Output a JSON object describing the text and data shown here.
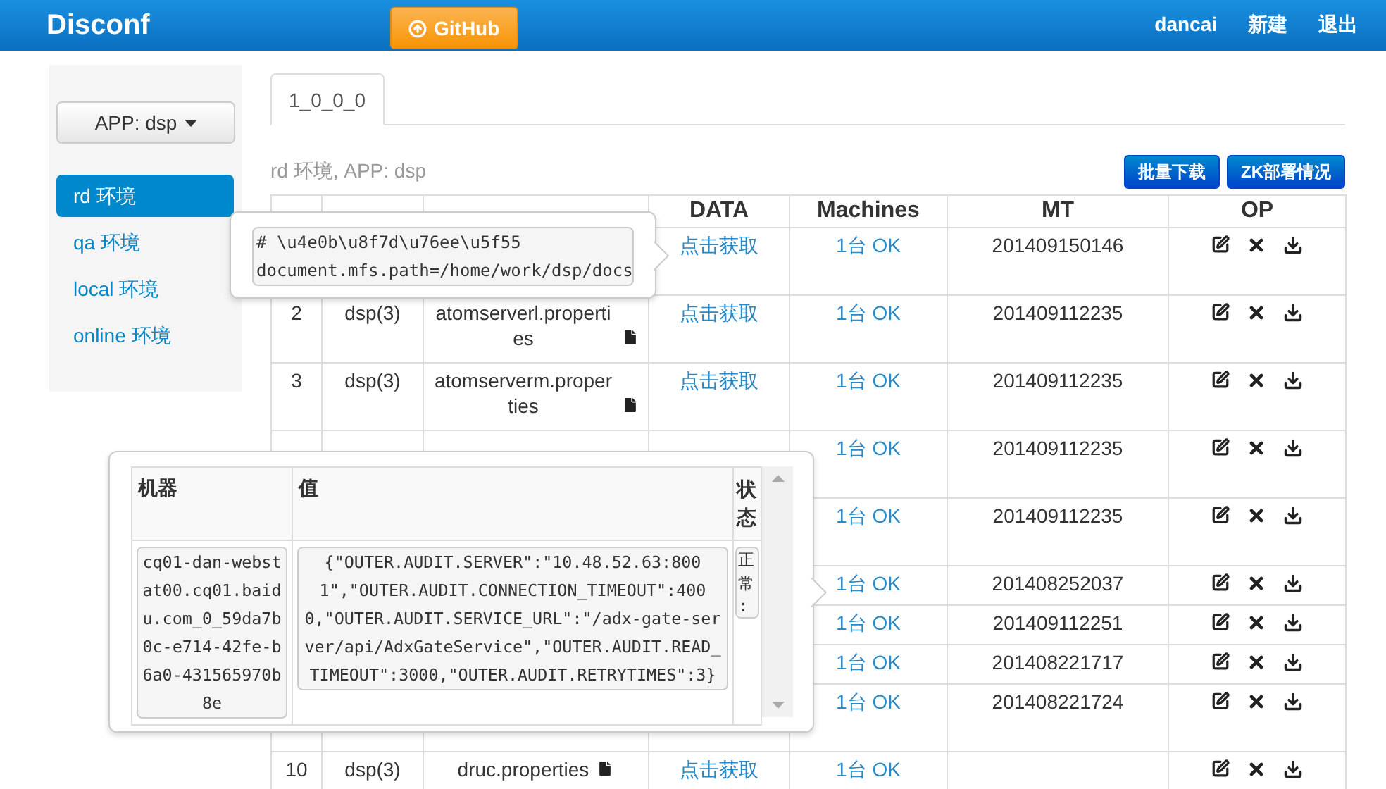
{
  "navbar": {
    "brand": "Disconf",
    "github_button": "GitHub",
    "links": [
      "dancai",
      "新建",
      "退出"
    ]
  },
  "sidebar": {
    "app_selector": "APP: dsp",
    "items": [
      {
        "label": "rd 环境",
        "selected": true
      },
      {
        "label": "qa 环境",
        "selected": false
      },
      {
        "label": "local 环境",
        "selected": false
      },
      {
        "label": "online 环境",
        "selected": false
      }
    ]
  },
  "tabs": [
    {
      "label": "1_0_0_0",
      "selected": true
    }
  ],
  "heading": "rd 环境, APP: dsp",
  "buttons": [
    "批量下载",
    "ZK部署情况"
  ],
  "table": {
    "columns": [
      "DATA",
      "Machines",
      "MT",
      "OP"
    ],
    "rows": [
      {
        "kind": "wrapped",
        "data": "点击获取",
        "machines": "1台 OK",
        "mt": "201409150146"
      },
      {
        "kind": "wrapped",
        "index": "2",
        "app": "dsp(3)",
        "key": "atomserverl.properties",
        "data": "点击获取",
        "machines": "1台 OK",
        "mt": "201409112235"
      },
      {
        "kind": "wrapped",
        "index": "3",
        "app": "dsp(3)",
        "key": "atomserverm.properties",
        "data": "点击获取",
        "machines": "1台 OK",
        "mt": "201409112235"
      },
      {
        "kind": "wrapped",
        "machines": "1台 OK",
        "mt": "201409112235"
      },
      {
        "kind": "wrapped",
        "machines": "1台 OK",
        "mt": "201409112235"
      },
      {
        "kind": "single",
        "machines": "1台 OK",
        "mt": "201408252037"
      },
      {
        "kind": "single",
        "machines": "1台 OK",
        "mt": "201409112251"
      },
      {
        "kind": "single",
        "machines": "1台 OK",
        "mt": "201408221717"
      },
      {
        "kind": "wrapped",
        "machines": "1台 OK",
        "mt": "201408221724"
      },
      {
        "kind": "single",
        "index": "10",
        "app": "dsp(3)",
        "key": "druc.properties",
        "data": "点击获取",
        "machines": "1台 OK"
      }
    ]
  },
  "config_popover": {
    "lines": [
      "# \\u4e0b\\u8f7d\\u76ee\\u5f55",
      "document.mfs.path=/home/work/dsp/docs"
    ]
  },
  "machines_popover": {
    "columns": [
      "机器",
      "值",
      "状态"
    ],
    "rows": [
      {
        "machine": "cq01-dan-webstat00.cq01.baidu.com_0_59da7b0c-e714-42fe-b6a0-431565970b8e",
        "value": "{\"OUTER.AUDIT.SERVER\":\"10.48.52.63:8001\",\"OUTER.AUDIT.CONNECTION_TIMEOUT\":4000,\"OUTER.AUDIT.SERVICE_URL\":\"/adx-gate-server/api/AdxGateService\",\"OUTER.AUDIT.READ_TIMEOUT\":3000,\"OUTER.AUDIT.RETRYTIMES\":3}",
        "status": "正常:"
      }
    ]
  }
}
